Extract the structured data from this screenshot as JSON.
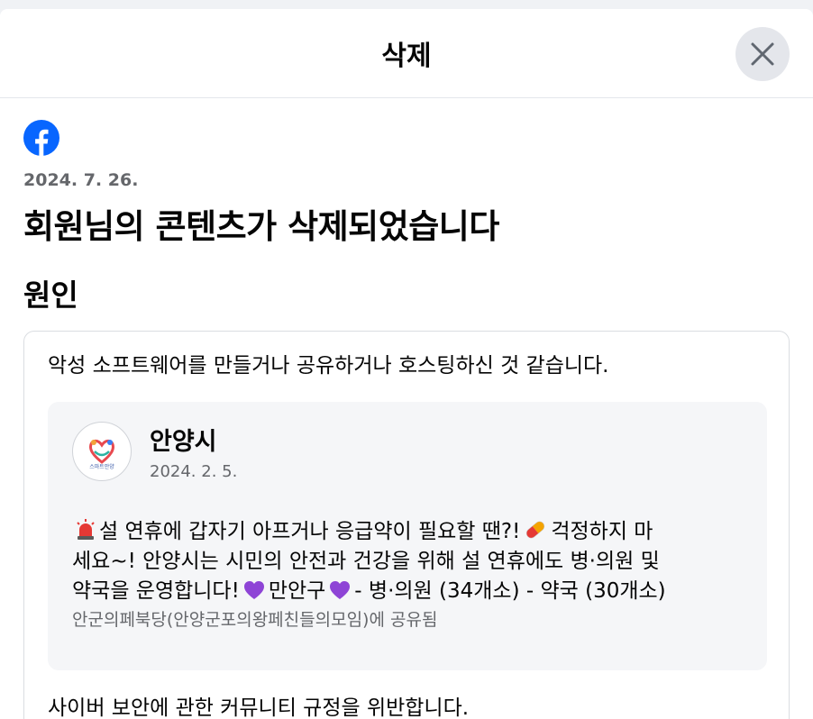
{
  "dialog": {
    "title": "삭제",
    "close_icon": "close-icon"
  },
  "notice": {
    "brand_icon": "facebook-logo-icon",
    "brand_color": "#0866ff",
    "date": "2024. 7. 26.",
    "title": "회원님의 콘텐츠가 삭제되었습니다",
    "section_title": "원인",
    "reason": "악성 소프트웨어를 만들거나 공유하거나 호스팅하신 것 같습니다.",
    "policy": "사이버 보안에 관한 커뮤니티 규정을 위반합니다."
  },
  "post": {
    "author": "안양시",
    "date": "2024. 2. 5.",
    "avatar_icon": "anyang-city-logo-icon",
    "avatar_label": "스마트안양",
    "line1_a": "설 연휴에 갑자기 아프거나 응급약이 필요할 땐?!",
    "line1_b": "걱정하지 마",
    "line2": "세요~! 안양시는 시민의 안전과 건강을 위해 설 연휴에도 병·의원 및",
    "line3_a": "약국을 운영합니다!",
    "line3_b": "만안구",
    "line3_c": "- 병·의원 (34개소) - 약국 (30개소)",
    "shared_in": "안군의페북당(안양군포의왕페친들의모임)에 공유됨"
  }
}
